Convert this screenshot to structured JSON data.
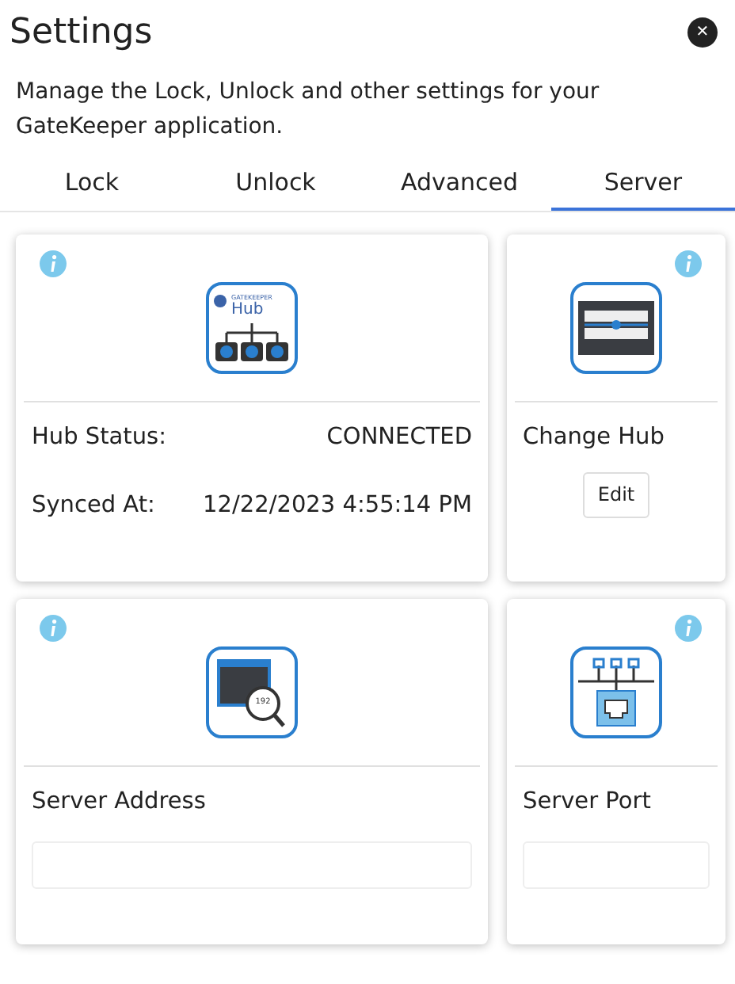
{
  "window": {
    "title": "Settings",
    "close": "✕"
  },
  "description": "Manage the Lock, Unlock and other settings for your GateKeeper application.",
  "tabs": [
    {
      "label": "Lock",
      "selected": false
    },
    {
      "label": "Unlock",
      "selected": false
    },
    {
      "label": "Advanced",
      "selected": false
    },
    {
      "label": "Server",
      "selected": true
    }
  ],
  "cards": [
    {
      "kind": "status",
      "logo_brand": "GATEKEEPER",
      "logo_name": "Hub",
      "rows": [
        {
          "label": "Hub Status:",
          "value": "CONNECTED"
        },
        {
          "label": "Synced At:",
          "value": "12/22/2023 4:55:14 PM"
        }
      ]
    },
    {
      "kind": "action",
      "label": "Change Hub",
      "button": "Edit"
    },
    {
      "kind": "field",
      "icon_text": "192",
      "label": "Server Address"
    },
    {
      "kind": "field",
      "label": "Server Port"
    }
  ]
}
